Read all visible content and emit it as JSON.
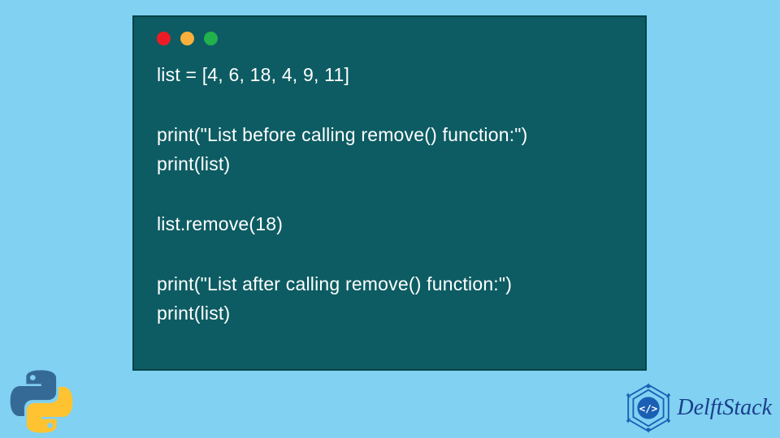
{
  "code_window": {
    "traffic_lights": {
      "red": "#ed1c24",
      "yellow": "#fbb03b",
      "green": "#22b14c"
    },
    "lines": [
      "list = [4, 6, 18, 4, 9, 11]",
      "",
      "print(\"List before calling remove() function:\")",
      "print(list)",
      "",
      "list.remove(18)",
      "",
      "print(\"List after calling remove() function:\")",
      "print(list)"
    ]
  },
  "brand": {
    "name": "DelftStack",
    "icon_color": "#1a5fb4"
  },
  "colors": {
    "page_bg": "#80d1f2",
    "window_bg": "#0d5c63",
    "code_text": "#ffffff"
  },
  "python_logo": {
    "blue": "#366a96",
    "yellow": "#ffc331"
  }
}
